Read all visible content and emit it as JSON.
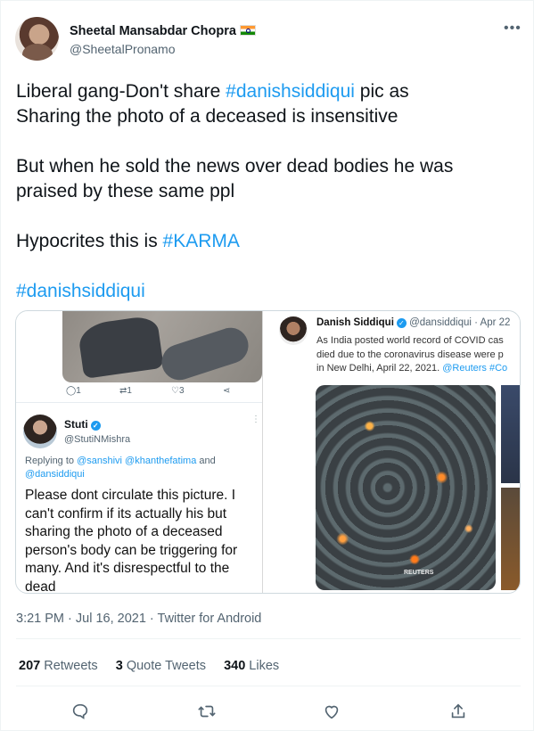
{
  "author": {
    "name": "Sheetal Mansabdar Chopra",
    "handle": "@SheetalPronamo"
  },
  "tweet": {
    "line1_pre": "Liberal gang-Don't share ",
    "line1_tag": "#danishsiddiqui",
    "line1_post": " pic as",
    "line2": "Sharing the photo of a deceased is insensitive",
    "para2_line1": "But when he sold the news over dead bodies he was",
    "para2_line2": "praised by these same ppl",
    "para3_pre": "Hypocrites this is ",
    "para3_tag": "#KARMA",
    "para4_tag": "#danishsiddiqui"
  },
  "media": {
    "left": {
      "reply_count": "1",
      "retweet_count": "1",
      "like_count": "3",
      "author_name": "Stuti",
      "author_handle": "@StutiNMishra",
      "replying_prefix": "Replying to ",
      "replying_to_1": "@sanshivi @khanthefatima",
      "replying_and": " and",
      "replying_to_2": "@dansiddiqui",
      "text": "Please dont circulate this picture. I can't confirm if its actually his but sharing the photo of a deceased person's body can be triggering for many. And it's disrespectful to the dead"
    },
    "right": {
      "author_name": "Danish Siddiqui",
      "author_handle": "@dansiddiqui",
      "date": " · Apr 22",
      "line1": "As India posted world record of COVID cas",
      "line2": "died due to the coronavirus disease were p",
      "line3_pre": "in New Delhi, April 22, 2021. ",
      "line3_link": "@Reuters #Co",
      "watermark": "REUTERS"
    }
  },
  "meta": {
    "time": "3:21 PM · Jul 16, 2021 · Twitter for Android"
  },
  "stats": {
    "retweets_count": "207",
    "retweets_label": " Retweets",
    "quotes_count": "3",
    "quotes_label": " Quote Tweets",
    "likes_count": "340",
    "likes_label": " Likes"
  },
  "icons": {
    "reply": "reply-icon",
    "retweet": "retweet-icon",
    "like": "heart-icon",
    "share": "share-icon",
    "more": "more-dots-icon"
  },
  "colors": {
    "link": "#1d9bf0",
    "text": "#0f1419",
    "secondary": "#536471"
  }
}
